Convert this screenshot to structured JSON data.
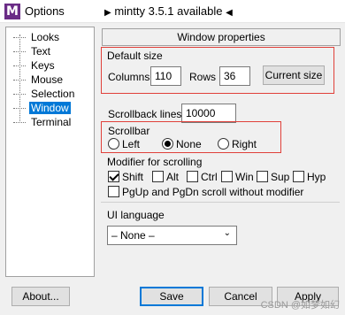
{
  "window": {
    "title": "Options",
    "notice": "mintty 3.5.1 available"
  },
  "tree": {
    "items": [
      {
        "label": "Looks"
      },
      {
        "label": "Text"
      },
      {
        "label": "Keys"
      },
      {
        "label": "Mouse"
      },
      {
        "label": "Selection"
      },
      {
        "label": "Window",
        "selected": true
      },
      {
        "label": "Terminal"
      }
    ]
  },
  "panel": {
    "header": "Window properties",
    "default_size": {
      "title": "Default size",
      "columns_label": "Columns",
      "columns_value": "110",
      "rows_label": "Rows",
      "rows_value": "36",
      "current_size_button": "Current size"
    },
    "scrollback": {
      "label": "Scrollback lines",
      "value": "10000"
    },
    "scrollbar": {
      "title": "Scrollbar",
      "options": [
        {
          "label": "Left",
          "selected": false
        },
        {
          "label": "None",
          "selected": true
        },
        {
          "label": "Right",
          "selected": false
        }
      ]
    },
    "modifier": {
      "title": "Modifier for scrolling",
      "options": [
        {
          "label": "Shift",
          "checked": true
        },
        {
          "label": "Alt",
          "checked": false
        },
        {
          "label": "Ctrl",
          "checked": false
        },
        {
          "label": "Win",
          "checked": false
        },
        {
          "label": "Sup",
          "checked": false
        },
        {
          "label": "Hyp",
          "checked": false
        }
      ],
      "pgup_label": "PgUp and PgDn scroll without modifier",
      "pgup_checked": false
    },
    "ui_language": {
      "title": "UI language",
      "selected": "– None –"
    }
  },
  "buttons": {
    "about": "About...",
    "save": "Save",
    "cancel": "Cancel",
    "apply": "Apply"
  },
  "watermark": "CSDN @如梦如幻"
}
